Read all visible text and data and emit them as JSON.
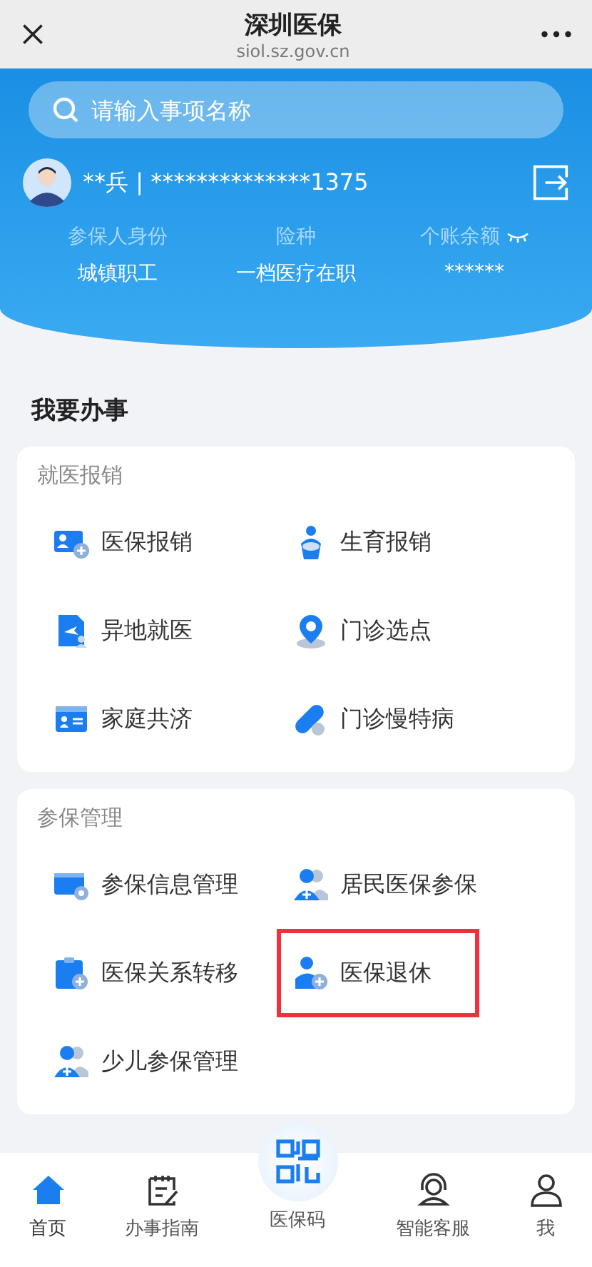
{
  "nav_bar": {
    "title": "深圳医保",
    "url": "siol.sz.gov.cn"
  },
  "search": {
    "placeholder": "请输入事项名称"
  },
  "user": {
    "name": "**兵 | **************1375"
  },
  "summary": [
    {
      "label": "参保人身份",
      "value": "城镇职工"
    },
    {
      "label": "险种",
      "value": "一档医疗在职"
    },
    {
      "label": "个账余额",
      "value": "******"
    }
  ],
  "section_title": "我要办事",
  "groups": [
    {
      "title": "就医报销",
      "items": [
        {
          "label": "医保报销",
          "highlighted": false
        },
        {
          "label": "生育报销",
          "highlighted": false
        },
        {
          "label": "异地就医",
          "highlighted": false
        },
        {
          "label": "门诊选点",
          "highlighted": false
        },
        {
          "label": "家庭共济",
          "highlighted": false
        },
        {
          "label": "门诊慢特病",
          "highlighted": false
        }
      ]
    },
    {
      "title": "参保管理",
      "items": [
        {
          "label": "参保信息管理",
          "highlighted": false
        },
        {
          "label": "居民医保参保",
          "highlighted": false
        },
        {
          "label": "医保关系转移",
          "highlighted": false
        },
        {
          "label": "医保退休",
          "highlighted": true
        },
        {
          "label": "少儿参保管理",
          "highlighted": false
        }
      ]
    }
  ],
  "tab_bar": [
    {
      "label": "首页",
      "selected": true
    },
    {
      "label": "办事指南",
      "selected": false
    },
    {
      "label": "医保码",
      "selected": false
    },
    {
      "label": "智能客服",
      "selected": false
    },
    {
      "label": "我",
      "selected": false
    }
  ]
}
